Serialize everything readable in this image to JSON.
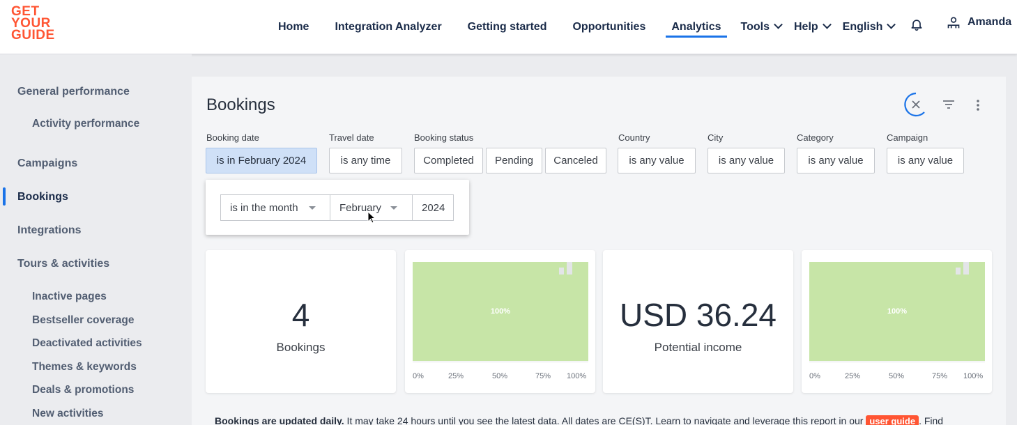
{
  "header": {
    "logo_lines": [
      "GET",
      "YOUR",
      "GUIDE"
    ],
    "nav": [
      {
        "label": "Home"
      },
      {
        "label": "Integration Analyzer"
      },
      {
        "label": "Getting started"
      },
      {
        "label": "Opportunities"
      },
      {
        "label": "Analytics",
        "active": true
      },
      {
        "label": "Tools",
        "dropdown": true
      },
      {
        "label": "Help",
        "dropdown": true
      },
      {
        "label": "English",
        "dropdown": true
      }
    ],
    "user_name": "Amanda",
    "icons": {
      "notifications": "bell-icon",
      "user": "user-icon"
    }
  },
  "sidebar": {
    "items": [
      {
        "label": "General performance"
      },
      {
        "label": "Activity performance",
        "sub": true
      },
      {
        "label": "Campaigns"
      },
      {
        "label": "Bookings",
        "active": true
      },
      {
        "label": "Integrations"
      },
      {
        "label": "Tours & activities"
      },
      {
        "label": "Inactive pages",
        "sub": true
      },
      {
        "label": "Bestseller coverage",
        "sub": true
      },
      {
        "label": "Deactivated activities",
        "sub": true
      },
      {
        "label": "Themes & keywords",
        "sub": true
      },
      {
        "label": "Deals & promotions",
        "sub": true
      },
      {
        "label": "New activities",
        "sub": true
      }
    ],
    "accent_color": "#1a73e8"
  },
  "main": {
    "title": "Bookings",
    "icons": {
      "close": "close-icon",
      "filter": "filter-icon",
      "more": "more-vert-icon"
    },
    "filters": {
      "booking_date": {
        "label": "Booking date",
        "value": "is in February 2024"
      },
      "travel_date": {
        "label": "Travel date",
        "value": "is any time"
      },
      "booking_status": {
        "label": "Booking status",
        "options": [
          "Completed",
          "Pending",
          "Canceled"
        ]
      },
      "country": {
        "label": "Country",
        "value": "is any value"
      },
      "city": {
        "label": "City",
        "value": "is any value"
      },
      "category": {
        "label": "Category",
        "value": "is any value"
      },
      "campaign": {
        "label": "Campaign",
        "value": "is any value"
      }
    },
    "date_popover": {
      "operator": "is in the month",
      "month": "February",
      "year": "2024"
    },
    "cards": {
      "bookings": {
        "value": "4",
        "caption": "Bookings"
      },
      "bookings_completion": {
        "fill_percent": 100,
        "label": "100%",
        "axis": [
          "0%",
          "25%",
          "50%",
          "75%",
          "100%"
        ]
      },
      "income": {
        "value": "USD 36.24",
        "caption": "Potential income"
      },
      "income_completion": {
        "fill_percent": 100,
        "label": "100%",
        "axis": [
          "0%",
          "25%",
          "50%",
          "75%",
          "100%"
        ]
      }
    },
    "bar_color": "#c7e5a7",
    "footer": {
      "bold": "Bookings are updated daily.",
      "text": " It may take 24 hours until you see the latest data. All dates are CE(S)T. Learn to navigate and leverage this report in our ",
      "badge": "user guide",
      "tail": ". Find"
    }
  }
}
